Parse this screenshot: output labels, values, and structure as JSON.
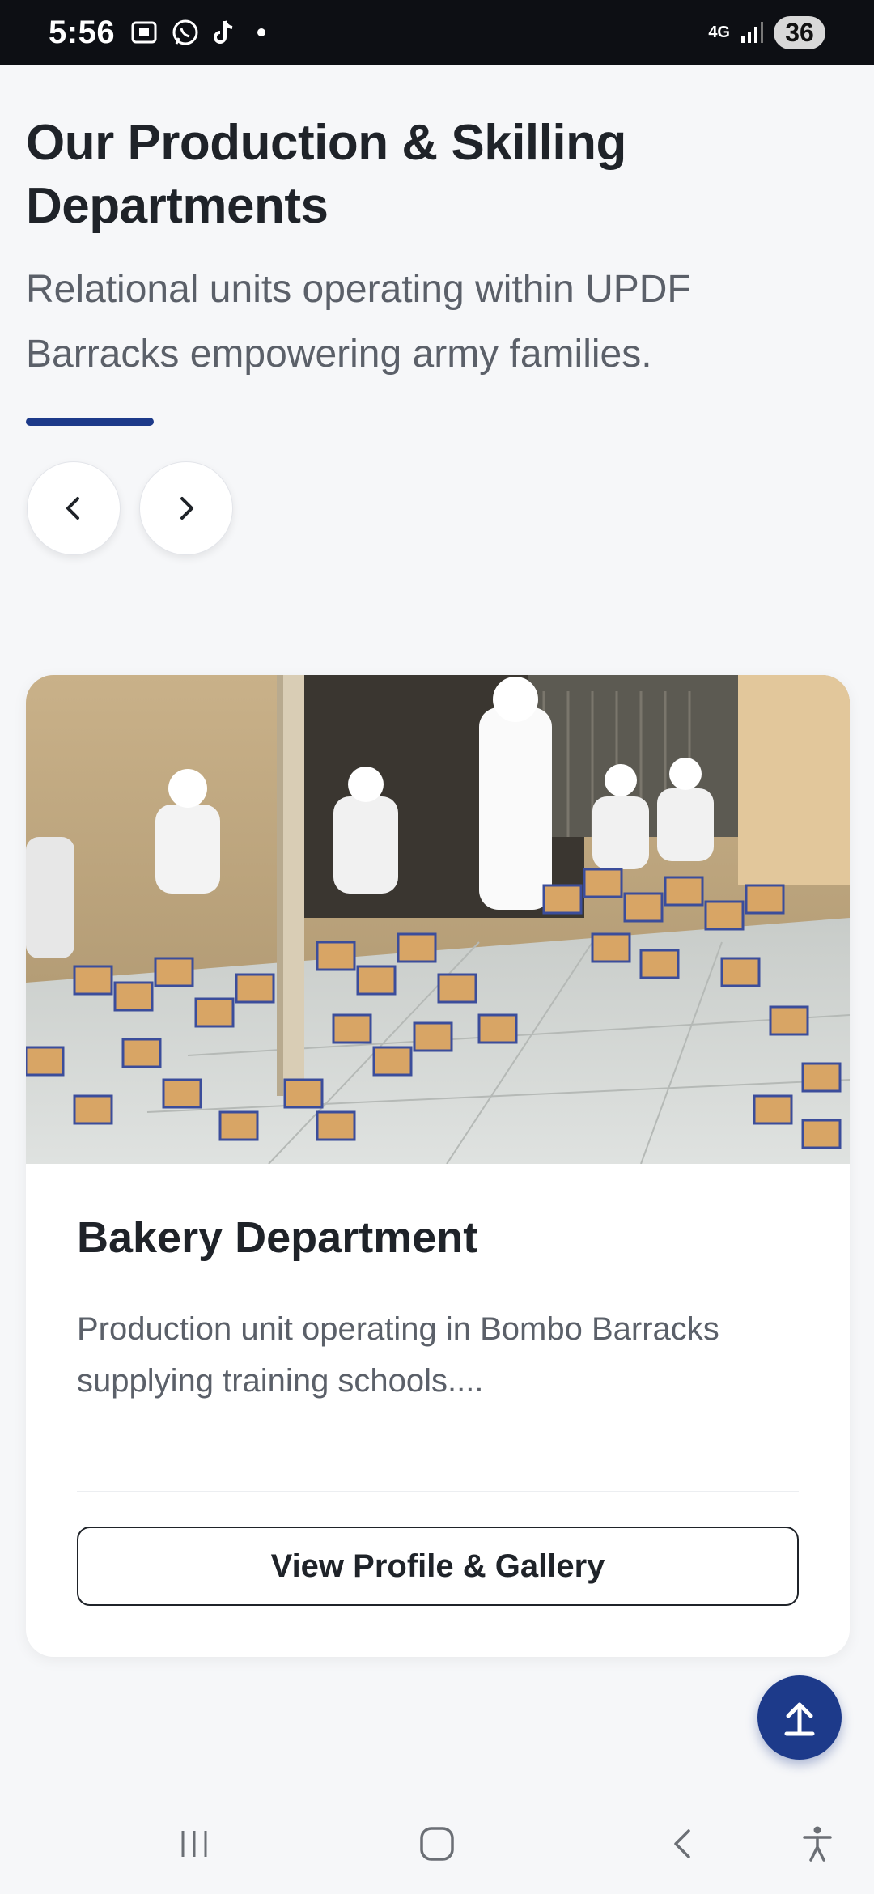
{
  "status_bar": {
    "time": "5:56",
    "network": "4G",
    "battery": "36"
  },
  "section": {
    "title": "Our Production & Skilling Departments",
    "subtitle": "Relational units operating within UPDF Barracks empowering army families.",
    "accent_color": "#1d3a8a"
  },
  "carousel": {
    "prev_icon": "chevron-left-icon",
    "next_icon": "chevron-right-icon"
  },
  "card": {
    "image_desc_icon": "bakery-photo",
    "title": "Bakery Department",
    "description": "Production unit operating in Bombo Barracks supplying training schools....",
    "button_label": "View Profile & Gallery"
  },
  "fab": {
    "icon": "arrow-up-icon"
  },
  "system_nav": {
    "recent_icon": "recent-apps-icon",
    "home_icon": "home-icon",
    "back_icon": "back-icon",
    "accessibility_icon": "accessibility-icon"
  }
}
